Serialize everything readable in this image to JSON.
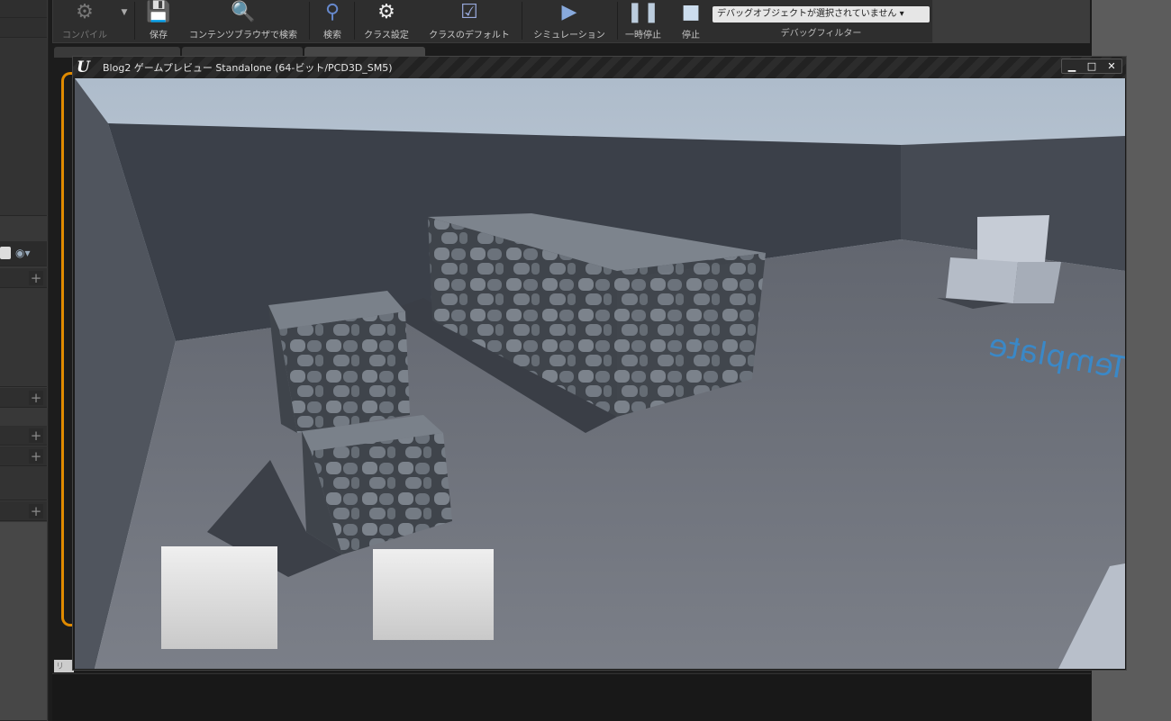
{
  "toolbar": {
    "buttons": [
      {
        "label": "コンパイル",
        "icon": "compile-icon"
      },
      {
        "label": "保存",
        "icon": "save-icon"
      },
      {
        "label": "コンテンツブラウザで検索",
        "icon": "browse-icon"
      },
      {
        "label": "検索",
        "icon": "find-icon"
      },
      {
        "label": "クラス設定",
        "icon": "class-settings-icon"
      },
      {
        "label": "クラスのデフォルト",
        "icon": "class-defaults-icon"
      },
      {
        "label": "シミュレーション",
        "icon": "simulation-icon"
      },
      {
        "label": "一時停止",
        "icon": "pause-icon"
      },
      {
        "label": "停止",
        "icon": "stop-icon"
      }
    ],
    "debug_filter": {
      "selected": "デバッグオブジェクトが選択されていません",
      "label": "デバッグフィルター"
    }
  },
  "game_window": {
    "title": "Blog2 ゲームプレビュー Standalone (64-ビット/PCD3D_SM5)",
    "logo": "U",
    "controls": {
      "minimize": "▁",
      "maximize": "□",
      "close": "✕"
    },
    "floor_text": "Template"
  },
  "output": {
    "input_placeholder": "リ"
  },
  "colors": {
    "accent_orange": "#e08a00",
    "floor_text": "#2f8fdc"
  }
}
